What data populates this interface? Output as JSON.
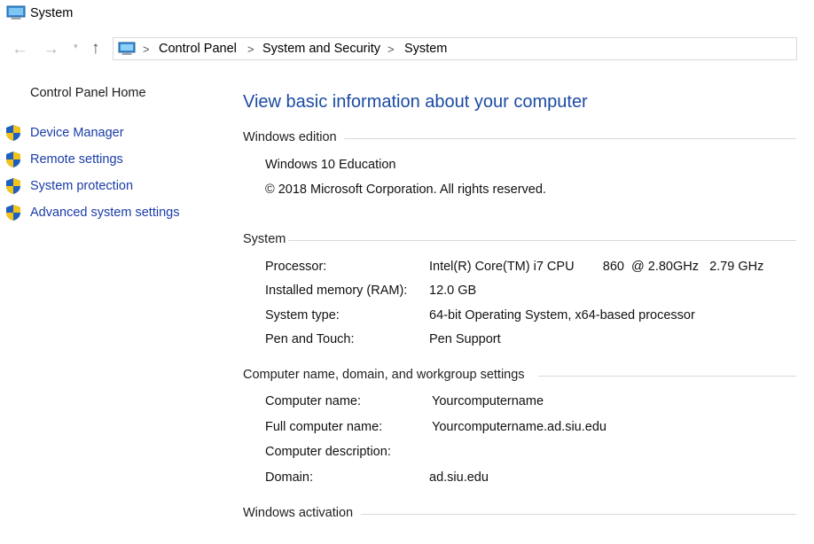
{
  "window": {
    "title": "System"
  },
  "nav": {
    "breadcrumb": [
      "Control Panel",
      "System and Security",
      "System"
    ],
    "separator": ">"
  },
  "sidebar": {
    "home": "Control Panel Home",
    "items": [
      {
        "label": "Device Manager",
        "icon": "shield-icon"
      },
      {
        "label": "Remote settings",
        "icon": "shield-icon"
      },
      {
        "label": "System protection",
        "icon": "shield-icon"
      },
      {
        "label": "Advanced system settings",
        "icon": "shield-icon"
      }
    ]
  },
  "main": {
    "heading": "View basic information about your computer",
    "edition": {
      "header": "Windows edition",
      "name": "Windows 10 Education",
      "copyright": "© 2018 Microsoft Corporation. All rights reserved."
    },
    "system": {
      "header": "System",
      "rows": [
        {
          "label": "Processor:",
          "value": "Intel(R) Core(TM) i7 CPU        860  @ 2.80GHz   2.79 GHz"
        },
        {
          "label": "Installed memory (RAM):",
          "value": "12.0 GB"
        },
        {
          "label": "System type:",
          "value": "64-bit Operating System, x64-based processor"
        },
        {
          "label": "Pen and Touch:",
          "value": "Pen Support"
        }
      ]
    },
    "computer": {
      "header": "Computer name, domain, and workgroup settings",
      "rows": [
        {
          "label": "Computer name:",
          "value": "Yourcomputername"
        },
        {
          "label": "Full computer name:",
          "value": "Yourcomputername.ad.siu.edu"
        },
        {
          "label": "Computer description:",
          "value": ""
        },
        {
          "label": "Domain:",
          "value": "ad.siu.edu"
        }
      ]
    },
    "activation": {
      "header": "Windows activation"
    }
  },
  "colors": {
    "link": "#1a3da8",
    "heading": "#1b4ba3",
    "rule": "#d9d9d9"
  }
}
